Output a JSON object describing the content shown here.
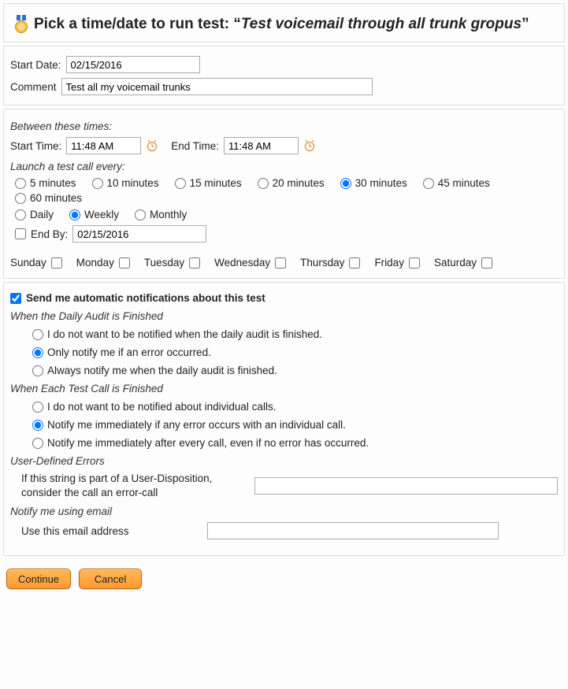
{
  "title": {
    "prefix": "Pick a time/date to run test: ",
    "quote_open": "“",
    "name": "Test voicemail through all trunk gropus",
    "quote_close": "”"
  },
  "topPanel": {
    "startDateLabel": "Start Date:",
    "startDate": "02/15/2016",
    "commentLabel": "Comment",
    "comment": "Test all my voicemail trunks"
  },
  "timesPanel": {
    "between": "Between these times:",
    "startTimeLabel": "Start Time:",
    "startTime": "11:48 AM",
    "endTimeLabel": "End Time:",
    "endTime": "11:48 AM",
    "launchEvery": "Launch a test call every:",
    "interval": {
      "opt5": "5 minutes",
      "opt10": "10 minutes",
      "opt15": "15 minutes",
      "opt20": "20 minutes",
      "opt30": "30 minutes",
      "opt45": "45 minutes",
      "opt60": "60 minutes",
      "selected": "30"
    },
    "recur": {
      "daily": "Daily",
      "weekly": "Weekly",
      "monthly": "Monthly",
      "selected": "weekly"
    },
    "endByLabel": "End By:",
    "endByChecked": false,
    "endBy": "02/15/2016",
    "days": {
      "sunday": "Sunday",
      "monday": "Monday",
      "tuesday": "Tuesday",
      "wednesday": "Wednesday",
      "thursday": "Thursday",
      "friday": "Friday",
      "saturday": "Saturday"
    }
  },
  "notifPanel": {
    "sendMe": "Send me automatic notifications about this test",
    "sendMeChecked": true,
    "dailyHeading": "When the Daily Audit is Finished",
    "daily": {
      "none": "I do not want to be notified when the daily audit is finished.",
      "error": "Only notify me if an error occurred.",
      "always": "Always notify me when the daily audit is finished.",
      "selected": "error"
    },
    "callHeading": "When Each Test Call is Finished",
    "call": {
      "none": "I do not want to be notified about individual calls.",
      "error": "Notify me immediately if any error occurs with an individual call.",
      "always": "Notify me immediately after every call, even if no error has occurred.",
      "selected": "error"
    },
    "userErrHeading": "User-Defined Errors",
    "userErrLabel": "If this string is part of a User-Disposition, consider the call an error-call",
    "userErrValue": "",
    "emailHeading": "Notify me using email",
    "emailLabel": "Use this email address",
    "emailValue": ""
  },
  "buttons": {
    "continue": "Continue",
    "cancel": "Cancel"
  }
}
